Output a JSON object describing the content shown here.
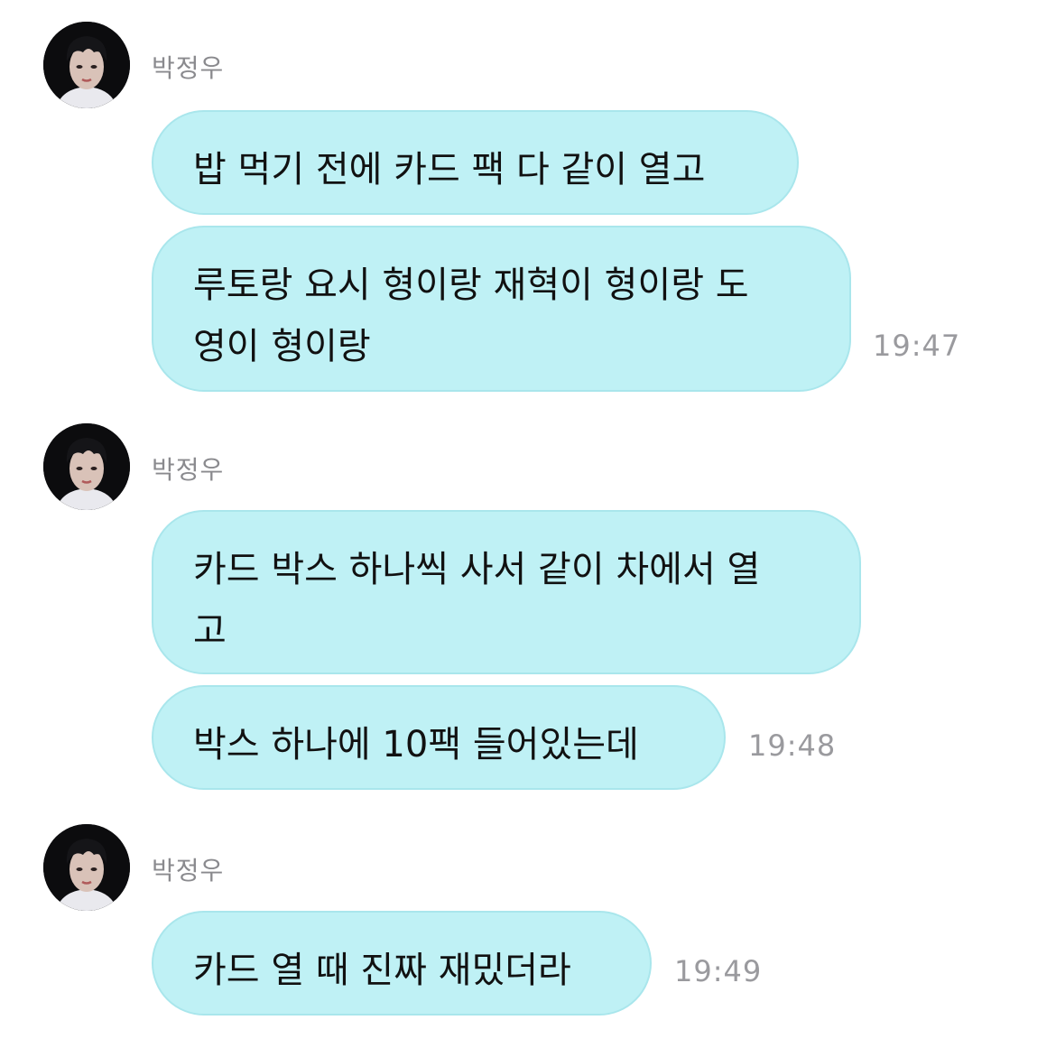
{
  "messages": [
    {
      "sender": "박정우",
      "bubbles": [
        "밥 먹기 전에 카드 팩 다 같이 열고",
        "루토랑 요시 형이랑 재혁이 형이랑 도\n영이 형이랑"
      ],
      "time": "19:47"
    },
    {
      "sender": "박정우",
      "bubbles": [
        "카드 박스 하나씩 사서 같이 차에서 열\n고",
        "박스 하나에 10팩 들어있는데"
      ],
      "time": "19:48"
    },
    {
      "sender": "박정우",
      "bubbles": [
        "카드 열 때 진짜 재밌더라"
      ],
      "time": "19:49"
    }
  ]
}
